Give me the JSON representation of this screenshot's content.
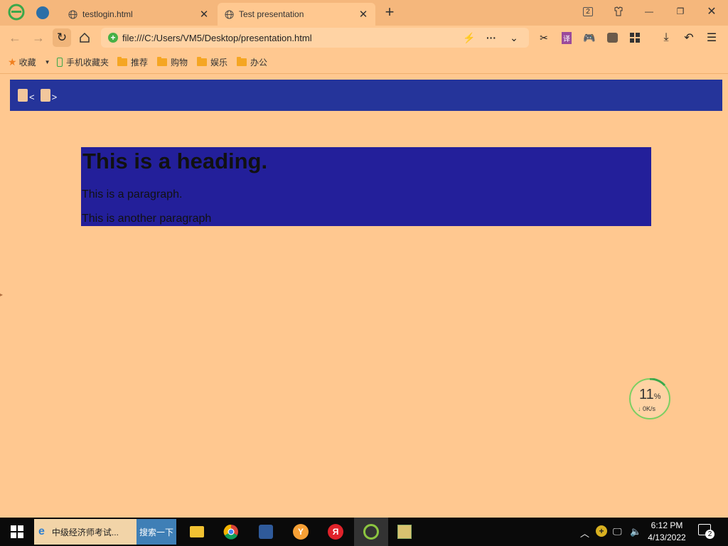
{
  "browser": {
    "tabs": [
      {
        "label": "testlogin.html",
        "active": false
      },
      {
        "label": "Test presentation",
        "active": true
      }
    ],
    "tab_count_badge": "2",
    "address": "file:///C:/Users/VM5/Desktop/presentation.html"
  },
  "bookmarks": {
    "favorites": "收藏",
    "items": [
      "手机收藏夹",
      "推荐",
      "购物",
      "娱乐",
      "办公"
    ]
  },
  "page": {
    "nav_prev": "<",
    "nav_next": ">",
    "heading": "This is a heading.",
    "paragraph1": "This is a paragraph.",
    "paragraph2": "This is another paragraph",
    "colors": {
      "nav_bar": "#25349a",
      "slide_bg": "#231f9a",
      "page_bg": "#ffc890"
    }
  },
  "speed_widget": {
    "percent": "11",
    "percent_unit": "%",
    "speed": "0K/s"
  },
  "taskbar": {
    "search_text": "中级经济师考试...",
    "search_button": "搜索一下",
    "time": "6:12 PM",
    "date": "4/13/2022",
    "notification_count": "2"
  }
}
